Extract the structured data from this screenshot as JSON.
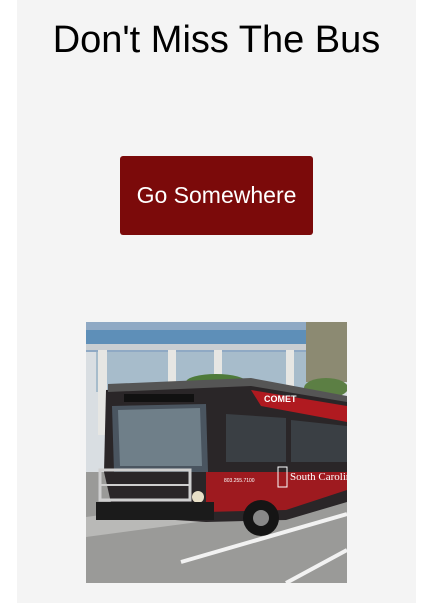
{
  "header": {
    "title": "Don't Miss The Bus"
  },
  "actions": {
    "go_label": "Go Somewhere"
  },
  "photo": {
    "description_icon": "bus-photo",
    "bus_brand": "COMET",
    "bus_side_text": "South Carolina",
    "bus_phone": "803.255.7100",
    "colors": {
      "button": "#7b0a0a",
      "bus_body": "#2a2628",
      "bus_accent": "#b01a20"
    }
  }
}
